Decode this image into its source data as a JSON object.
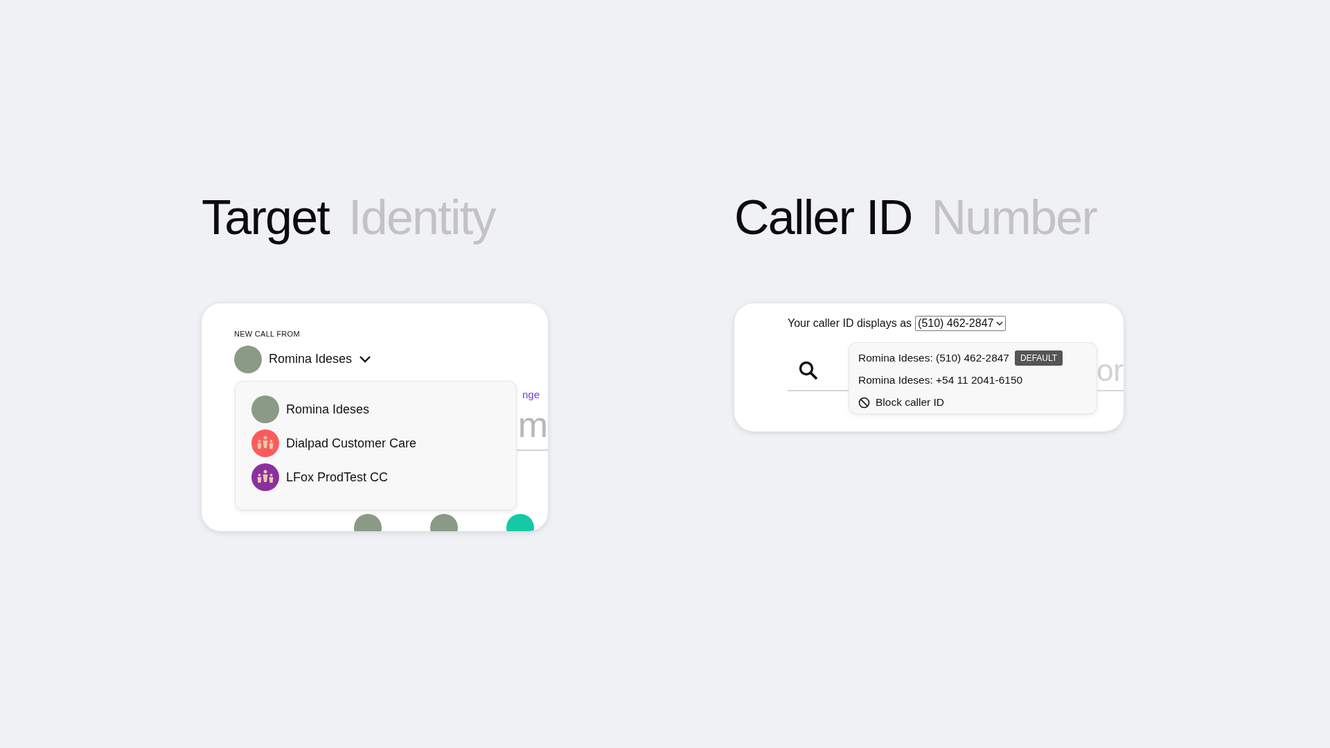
{
  "headings": [
    {
      "strong": "Target",
      "light": "Identity"
    },
    {
      "strong": "Caller ID",
      "light": "Number"
    }
  ],
  "target_card": {
    "label": "NEW CALL FROM",
    "selected_identity": "Romina Ideses",
    "link": "nge",
    "background_text": "m",
    "menu": [
      {
        "name": "Romina Ideses",
        "kind": "person"
      },
      {
        "name": "Dialpad Customer Care",
        "kind": "team",
        "color": "#fb5b5e"
      },
      {
        "name": "LFox ProdTest CC",
        "kind": "team",
        "color": "#8b2fa0"
      }
    ],
    "bottom_avatars": [
      {
        "kind": "photo"
      },
      {
        "kind": "photo"
      },
      {
        "kind": "badge",
        "color": "#14c9a6"
      }
    ]
  },
  "caller_card": {
    "prompt": "Your caller ID displays as",
    "value": "(510) 462-2847",
    "background_text": "or",
    "options": [
      {
        "label": "Romina Ideses: (510) 462-2847",
        "badge": "DEFAULT",
        "kind": "number"
      },
      {
        "label": "Romina Ideses: +54 11 2041-6150",
        "kind": "number"
      },
      {
        "label": "Block caller ID",
        "kind": "block"
      }
    ]
  }
}
